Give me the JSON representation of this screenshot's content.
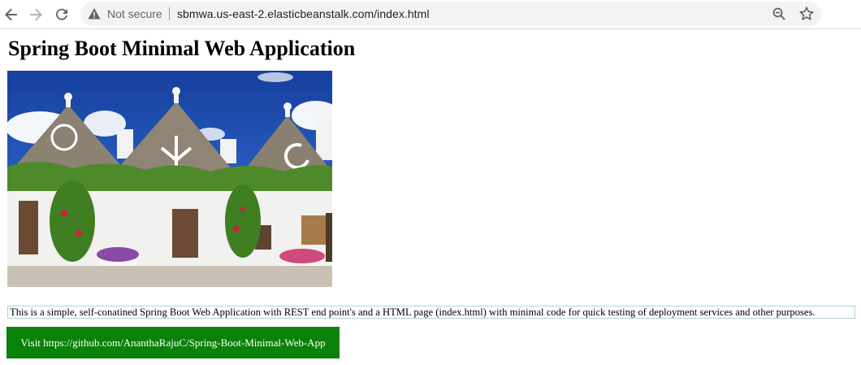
{
  "browser": {
    "security_label": "Not secure",
    "url": "sbmwa.us-east-2.elasticbeanstalk.com/index.html",
    "icons": [
      "back-arrow-icon",
      "forward-arrow-icon",
      "reload-icon",
      "warning-icon",
      "zoom-icon",
      "star-icon"
    ]
  },
  "page": {
    "title": "Spring Boot Minimal Web Application",
    "description": "This is a simple, self-conatined Spring Boot Web Application with REST end point's and a HTML page (index.html) with minimal code for quick testing of deployment services and other purposes.",
    "visit_button": "Visit https://github.com/AnanthaRajuC/Spring-Boot-Minimal-Web-App"
  },
  "colors": {
    "button_bg": "#0a8108",
    "button_text": "#ffffff",
    "omnibox_bg": "#f1f3f4",
    "sky": "#1f58c4"
  }
}
